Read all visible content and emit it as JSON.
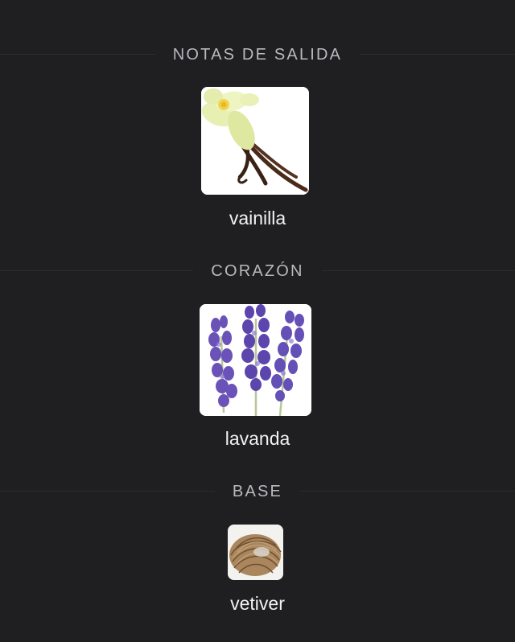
{
  "sections": [
    {
      "title": "NOTAS DE SALIDA",
      "note": {
        "name": "vainilla",
        "image": "vanilla-flower-and-pods"
      }
    },
    {
      "title": "CORAZÓN",
      "note": {
        "name": "lavanda",
        "image": "lavender-sprigs"
      }
    },
    {
      "title": "BASE",
      "note": {
        "name": "vetiver",
        "image": "vetiver-root-bundle"
      }
    }
  ],
  "colors": {
    "background": "#1f1f21",
    "section_title": "#b9b9bd",
    "note_name": "#f2f2f4",
    "divider": "#2c2c2e"
  }
}
